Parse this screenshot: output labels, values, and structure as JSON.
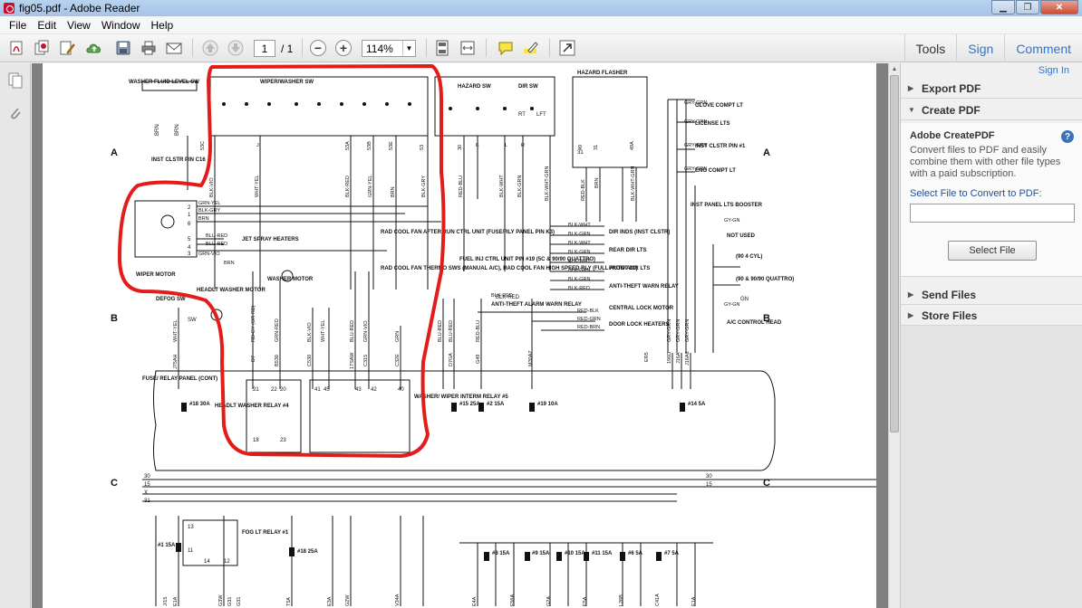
{
  "window": {
    "title": "fig05.pdf - Adobe Reader",
    "minimize": "▁",
    "restore": "❐",
    "close": "✕"
  },
  "menu": [
    "File",
    "Edit",
    "View",
    "Window",
    "Help"
  ],
  "toolbar": {
    "page_current": "1",
    "page_total": "/ 1",
    "zoom": "114%",
    "tools_label": "Tools",
    "sign_label": "Sign",
    "comment_label": "Comment"
  },
  "right_pane": {
    "sign_in": "Sign In",
    "export_pdf": "Export PDF",
    "create_pdf": "Create PDF",
    "create_heading": "Adobe CreatePDF",
    "create_desc": "Convert files to PDF and easily combine them with other file types with a paid subscription.",
    "select_label": "Select File to Convert to PDF:",
    "select_button": "Select File",
    "send_files": "Send Files",
    "store_files": "Store Files"
  },
  "diagram": {
    "row_labels": [
      "A",
      "B",
      "C"
    ],
    "titles": {
      "washer_fluid": "WASHER FLUID LEVEL SW",
      "wiper_washer_sw": "WIPER/WASHER SW",
      "hazard_sw": "HAZARD SW",
      "dir_sw": "DIR SW",
      "hazard_flasher": "HAZARD FLASHER",
      "inst_clstr": "INST CLSTR PIN C16",
      "wiper_motor": "WIPER MOTOR",
      "jet_spray": "JET SPRAY HEATERS",
      "headlt_washer_motor": "HEADLT WASHER MOTOR",
      "washer_motor": "WASHER MOTOR",
      "defog": "DEFOG SW",
      "rad_cool_after": "RAD COOL FAN AFTER RUN CTRL UNIT (FUSE/RLY PANEL PIN K3)",
      "rad_cool_thermo": "RAD COOL FAN THERMO SWS (MANUAL A/C), RAD COOL FAN HIGH SPEED RLY (FULL AUTO A/C)",
      "fuel_inj": "FUEL INJ CTRL UNIT PIN #19 (5C & 90/90 QUATTRO)",
      "anti_theft_alarm": "ANTI-THEFT ALARM WARN RELAY",
      "glove": "GLOVE COMPT LT",
      "license": "LICENSE LTS",
      "inst_clstr_pin1": "INST CLSTR PIN #1",
      "eng_compt": "ENG COMPT LT",
      "inst_panel_lts": "INST PANEL LTS BOOSTER",
      "not_used": "NOT USED",
      "four_cyl": "(90 4 CYL)",
      "quattro": "(90 & 90/90 QUATTRO)",
      "ac_control": "A/C CONTROL HEAD",
      "dir_inds": "DIR INDS (INST CLSTR)",
      "rear_dir": "REAR DIR LTS",
      "front_dir": "FRONT DIR LTS",
      "anti_theft_warn": "ANTI-THEFT WARN RELAY",
      "central_lock": "CENTRAL LOCK MOTOR",
      "door_lock": "DOOR LOCK HEATERS",
      "fuse_relay_panel": "FUSE/ RELAY PANEL (CONT)",
      "headlt_washer_relay": "HEADLT WASHER RELAY #4",
      "washer_interm_relay": "WASHER/ WIPER INTERM RELAY #5",
      "fog_relay": "FOG LT RELAY #1"
    },
    "fuses": [
      {
        "label": "#18 30A"
      },
      {
        "label": "#15 25A"
      },
      {
        "label": "#2 15A"
      },
      {
        "label": "#19 10A"
      },
      {
        "label": "#14 5A"
      },
      {
        "label": "#18 25A"
      },
      {
        "label": "#8 15A"
      },
      {
        "label": "#9 15A"
      },
      {
        "label": "#10 15A"
      },
      {
        "label": "#11 15A"
      },
      {
        "label": "#6 5A"
      },
      {
        "label": "#7 5A"
      },
      {
        "label": "#1 15A"
      }
    ],
    "wires_top": [
      "BLK-VIO",
      "WHT-YEL",
      "BLK-RED",
      "GRN-YEL",
      "BRN",
      "BLK-GRY",
      "RED-BLU",
      "BLK-WHT",
      "BLK-GRN",
      "BLK-WHT-GRN",
      "RED-BLK",
      "BRN",
      "BLK-WHT-GRN",
      "GRY-GRN",
      "GRY-GRN",
      "GRY-GRN",
      "GRY-GRN"
    ],
    "wires_left": [
      "GRN-YEL",
      "BLK-GRY",
      "BRN",
      "BLU-RED",
      "BLU-RED",
      "GRN-VIO",
      "BRN"
    ],
    "wires_right": [
      "BLK-WHT",
      "BLK-GRN",
      "BLK-WHT",
      "BLK-GRN",
      "BLK-WHT",
      "BLK-GRN",
      "BLK-GRN",
      "BLK-RED",
      "BLK-RED",
      "RED-BLK",
      "RED-GRN",
      "RED-BRN",
      "GY-GN",
      "GY-GN"
    ],
    "wires_mid": [
      "WHT-YEL",
      "RD-GY (OR RD)",
      "GRN-RED",
      "BLK-VIO",
      "WHT-YEL",
      "BLU-RED",
      "GRN-VIO",
      "GRN",
      "BLU-RED",
      "BLU-RED",
      "RED-BLU",
      "GRY-GRN",
      "GRY-GRN",
      "GRY-GRN"
    ],
    "connectors_top": [
      "53C",
      "J",
      "53A",
      "53B",
      "53E",
      "53",
      "30",
      "K",
      "L",
      "R",
      "49",
      "31",
      "49A"
    ],
    "connectors_mid": [
      "J75AH",
      "D7",
      "B530",
      "C530",
      "17SAW",
      "C315",
      "C32E",
      "D7GA",
      "G49",
      "M30AZ",
      "ER5",
      "196D",
      "J16A",
      "J16A6"
    ],
    "terms": [
      "30",
      "15",
      "X",
      "31",
      "30",
      "15"
    ],
    "wiper_pins": [
      "2",
      "1",
      "6",
      "5",
      "4",
      "3"
    ],
    "relay_pins": [
      "21",
      "22",
      "20",
      "41",
      "45",
      "43",
      "42",
      "40",
      "18",
      "23"
    ],
    "fog_pins": [
      "13",
      "11",
      "14",
      "12"
    ],
    "sw_pins": [
      "RT",
      "LFT"
    ],
    "bottom_codes": [
      "J/15",
      "E1A",
      "G3W",
      "G31",
      "G31",
      "T5A",
      "E3A",
      "G2W",
      "V34A",
      "E4A",
      "F56A",
      "G2A",
      "E5A",
      "L26B",
      "C41A",
      "E1A"
    ],
    "misc": {
      "pin31": "31",
      "brn": "BRN",
      "bk_red": "BLK-RED",
      "gn": "GN",
      "sw_label": "SW",
      "br": "BRN"
    }
  }
}
